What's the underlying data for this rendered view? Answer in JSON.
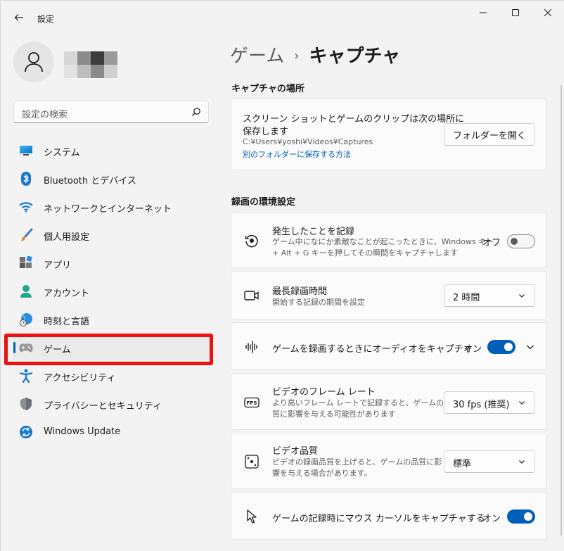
{
  "window": {
    "title": "設定",
    "controls": {
      "minimize": "minimize-icon",
      "maximize": "maximize-icon",
      "close": "close-icon"
    }
  },
  "search": {
    "placeholder": "設定の検索"
  },
  "sidebar": {
    "items": [
      {
        "label": "システム",
        "icon": "system-icon"
      },
      {
        "label": "Bluetooth とデバイス",
        "icon": "bluetooth-icon"
      },
      {
        "label": "ネットワークとインターネット",
        "icon": "wifi-icon"
      },
      {
        "label": "個人用設定",
        "icon": "brush-icon"
      },
      {
        "label": "アプリ",
        "icon": "apps-icon"
      },
      {
        "label": "アカウント",
        "icon": "account-icon"
      },
      {
        "label": "時刻と言語",
        "icon": "time-language-icon"
      },
      {
        "label": "ゲーム",
        "icon": "gamepad-icon",
        "selected": true
      },
      {
        "label": "アクセシビリティ",
        "icon": "accessibility-icon"
      },
      {
        "label": "プライバシーとセキュリティ",
        "icon": "shield-icon"
      },
      {
        "label": "Windows Update",
        "icon": "windows-update-icon"
      }
    ]
  },
  "breadcrumb": {
    "parent": "ゲーム",
    "separator": "›",
    "current": "キャプチャ"
  },
  "capture_location": {
    "section_title": "キャプチャの場所",
    "title_line1": "スクリーン ショットとゲームのクリップは次の場所に",
    "title_line2": "保存します",
    "path": "C:¥Users¥yoshi¥Videos¥Captures",
    "link": "別のフォルダーに保存する方法",
    "button": "フォルダーを開く"
  },
  "recording": {
    "section_title": "録画の環境設定",
    "record_what_happened": {
      "title": "発生したことを記録",
      "desc_line1": "ゲーム中になにか素敵なことが起こったときに、Windows キー",
      "desc_line2": "+ Alt + G キーを押してその瞬間をキャプチャします",
      "state_label": "オフ",
      "on": false
    },
    "max_length": {
      "title": "最長録画時間",
      "desc": "開始する記録の期間を設定",
      "value": "2 時間"
    },
    "capture_audio": {
      "title": "ゲームを録画するときにオーディオをキャプチャ",
      "state_label": "オン",
      "on": true
    },
    "frame_rate": {
      "title": "ビデオのフレーム レート",
      "desc_line1": "より高いフレーム レートで記録すると、ゲームの品",
      "desc_line2": "質に影響を与える可能性があります",
      "value": "30 fps (推奨)"
    },
    "video_quality": {
      "title": "ビデオ品質",
      "desc_line1": "ビデオの録画品質を上げると、ゲームの品質に影",
      "desc_line2": "響を与える場合があります。",
      "value": "標準"
    },
    "capture_cursor": {
      "title": "ゲームの記録時にマウス カーソルをキャプチャする",
      "state_label": "オン",
      "on": true
    }
  },
  "colors": {
    "accent": "#005fb8",
    "highlight": "#ee1111"
  }
}
